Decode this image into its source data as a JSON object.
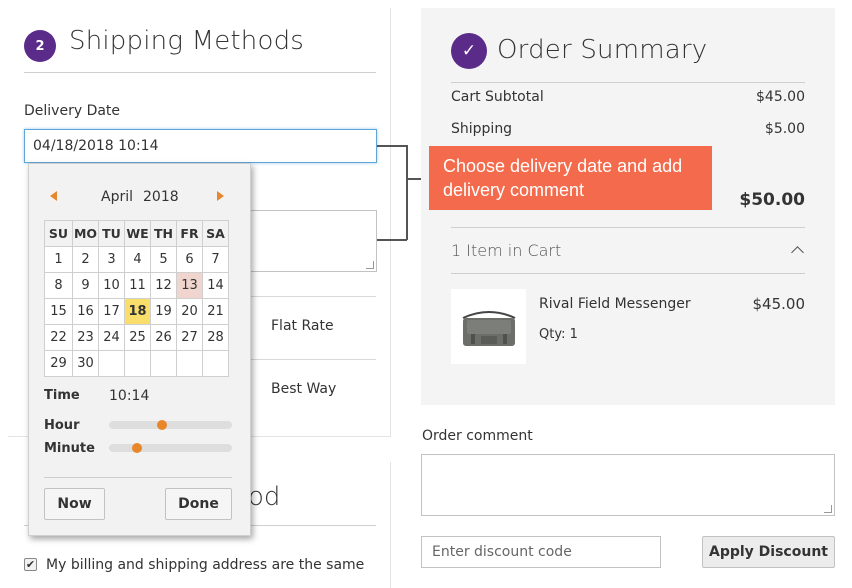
{
  "shipping": {
    "step_number": "2",
    "title": "Shipping Methods",
    "delivery_label": "Delivery Date",
    "delivery_value": "04/18/2018 10:14",
    "methods": [
      "Flat Rate",
      "Best Way"
    ]
  },
  "billing": {
    "title_visible_tail": "od",
    "same_address_label": "My billing and shipping address are the same",
    "same_address_checked": true
  },
  "calendar": {
    "month": "April",
    "year": "2018",
    "weekdays": [
      "SU",
      "MO",
      "TU",
      "WE",
      "TH",
      "FR",
      "SA"
    ],
    "weeks": [
      [
        "",
        "",
        "",
        "",
        "",
        "",
        ""
      ],
      [
        "1",
        "2",
        "3",
        "4",
        "5",
        "6",
        "7"
      ],
      [
        "8",
        "9",
        "10",
        "11",
        "12",
        "13",
        "14"
      ],
      [
        "15",
        "16",
        "17",
        "18",
        "19",
        "20",
        "21"
      ],
      [
        "22",
        "23",
        "24",
        "25",
        "26",
        "27",
        "28"
      ],
      [
        "29",
        "30",
        "",
        "",
        "",
        "",
        ""
      ]
    ],
    "today": "13",
    "selected": "18",
    "time_label": "Time",
    "time_value": "10:14",
    "hour_label": "Hour",
    "minute_label": "Minute",
    "hour_fraction": 0.43,
    "minute_fraction": 0.23,
    "now_label": "Now",
    "done_label": "Done",
    "accent_color": "#e8872a",
    "today_color": "#f0d4ce",
    "selected_color": "#f9de6b"
  },
  "callout": {
    "text": "Choose delivery date and add delivery comment",
    "color": "#f36b4c"
  },
  "summary": {
    "check_icon": "✓",
    "title": "Order Summary",
    "rows": [
      {
        "label": "Cart Subtotal",
        "value": "$45.00"
      },
      {
        "label": "Shipping",
        "value": "$5.00"
      }
    ],
    "total": "$50.00",
    "items_count_label": "1 Item in Cart",
    "item": {
      "name": "Rival Field Messenger",
      "qty": "Qty: 1",
      "price": "$45.00",
      "image_icon": "messenger-bag"
    },
    "badge_color": "#5b2b8a"
  },
  "order_comment": {
    "label": "Order comment"
  },
  "discount": {
    "placeholder": "Enter discount code",
    "button_label": "Apply Discount"
  }
}
